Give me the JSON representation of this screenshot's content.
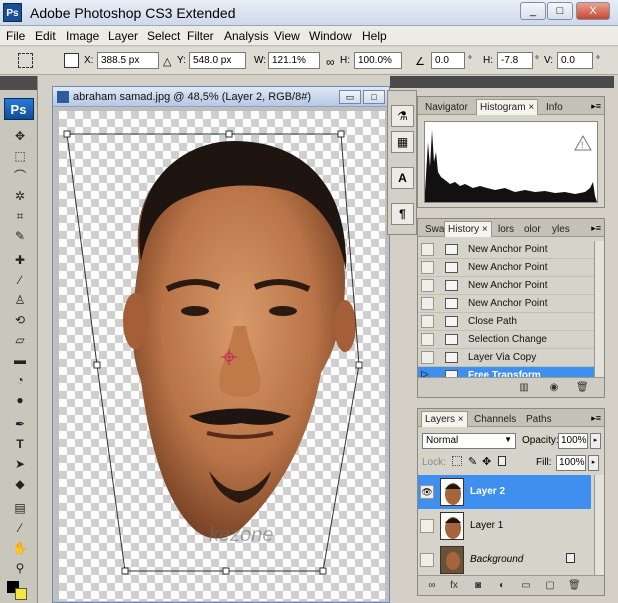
{
  "app": {
    "title": "Adobe Photoshop CS3 Extended",
    "logo": "Ps"
  },
  "window_buttons": [
    "_",
    "□",
    "X"
  ],
  "menu": [
    "File",
    "Edit",
    "Image",
    "Layer",
    "Select",
    "Filter",
    "Analysis",
    "View",
    "Window",
    "Help"
  ],
  "options": {
    "x_label": "X:",
    "x_value": "388.5 px",
    "y_label": "Y:",
    "y_value": "548.0 px",
    "w_label": "W:",
    "w_value": "121.1%",
    "h_label": "H:",
    "h_value": "100.0%",
    "angle_value": "0.0",
    "hskew_label": "H:",
    "hskew_value": "-7.8",
    "vskew_label": "V:",
    "vskew_value": "0.0",
    "unit_degree": "°"
  },
  "tools": {
    "badge": "Ps",
    "icons": [
      "move-tool-icon",
      "marquee-tool-icon",
      "lasso-tool-icon",
      "magic-wand-icon",
      "crop-tool-icon",
      "slice-tool-icon",
      "healing-brush-icon",
      "brush-tool-icon",
      "clone-stamp-icon",
      "history-brush-icon",
      "eraser-icon",
      "gradient-icon",
      "blur-icon",
      "dodge-icon",
      "pen-tool-icon",
      "type-tool-icon",
      "path-selection-icon",
      "shape-tool-icon",
      "notes-icon",
      "eyedropper-icon",
      "hand-tool-icon",
      "zoom-tool-icon",
      "color-swatch-icon"
    ]
  },
  "document": {
    "title": "abraham samad.jpg @ 48,5% (Layer 2, RGB/8#)",
    "watermark": "kezone"
  },
  "panels": {
    "navigator_tabs": [
      "Navigator",
      "Histogram ×",
      "Info"
    ],
    "history_tabs": [
      "Swa",
      "History ×",
      "lors",
      "olor",
      "yles"
    ],
    "history_items": [
      "New Anchor Point",
      "New Anchor Point",
      "New Anchor Point",
      "New Anchor Point",
      "Close Path",
      "Selection Change",
      "Layer Via Copy",
      "Free Transform"
    ],
    "history_active_index": 7,
    "layers_tabs": [
      "Layers ×",
      "Channels",
      "Paths"
    ],
    "blend_mode": "Normal",
    "opacity_label": "Opacity:",
    "opacity_value": "100%",
    "lock_label": "Lock:",
    "fill_label": "Fill:",
    "fill_value": "100%",
    "layers": [
      {
        "name": "Layer 2",
        "active": true,
        "visible": true,
        "locked": false
      },
      {
        "name": "Layer 1",
        "active": false,
        "visible": false,
        "locked": false
      },
      {
        "name": "Background",
        "active": false,
        "visible": false,
        "locked": true
      }
    ]
  },
  "colors": {
    "selection": "#3f8ff0",
    "panel": "#d6d3ca",
    "title_gradient_top": "#e9eef7"
  }
}
